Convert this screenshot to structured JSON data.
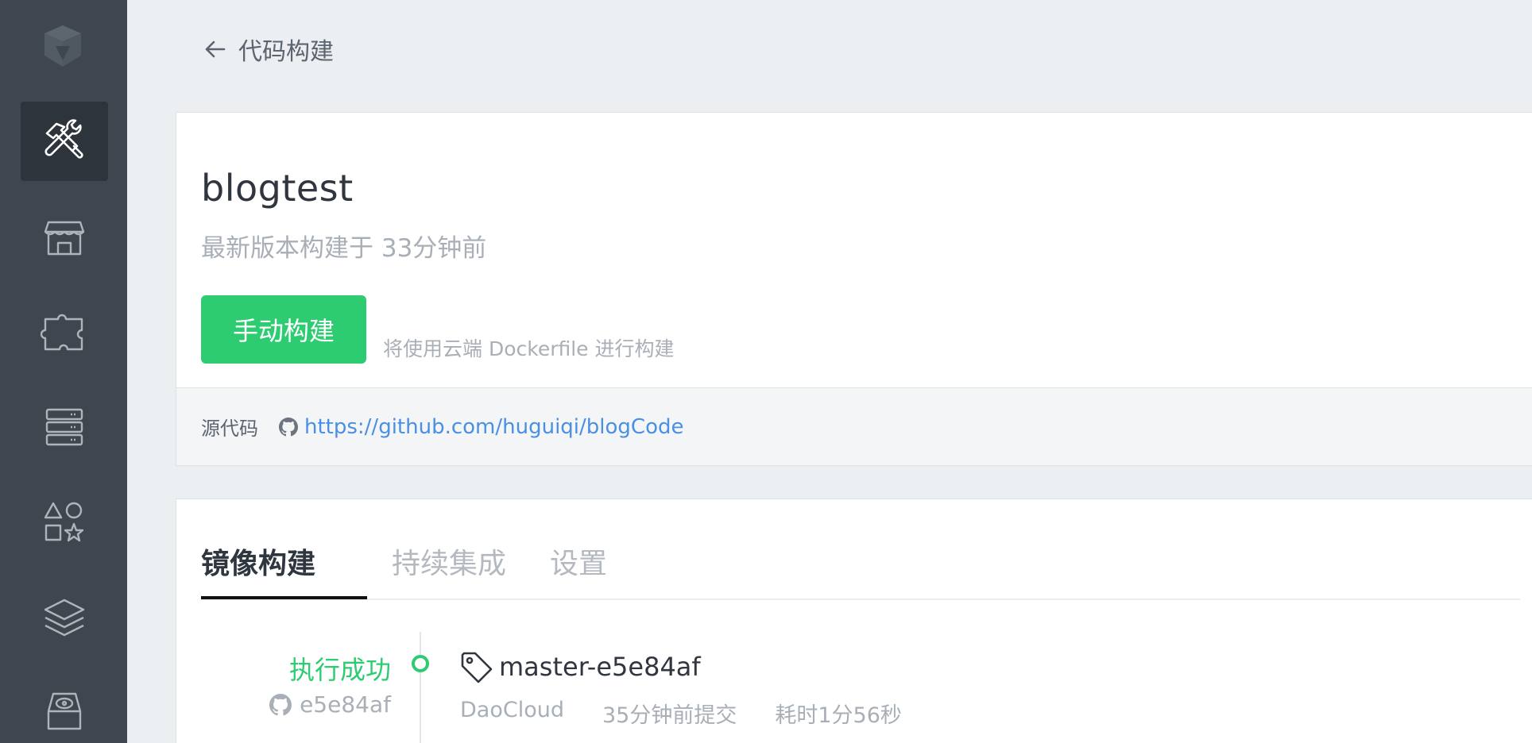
{
  "sidebar": {
    "logo": "daocloud-logo-icon",
    "items": [
      {
        "icon": "build-tools-icon",
        "active": true
      },
      {
        "icon": "store-icon",
        "active": false
      },
      {
        "icon": "puzzle-icon",
        "active": false
      },
      {
        "icon": "server-icon",
        "active": false
      },
      {
        "icon": "shapes-icon",
        "active": false
      },
      {
        "icon": "layers-icon",
        "active": false
      },
      {
        "icon": "disk-icon",
        "active": false
      }
    ]
  },
  "header": {
    "back_label": "代码构建"
  },
  "app": {
    "name": "blogtest",
    "subtitle": "最新版本构建于 33分钟前",
    "build_button": "手动构建",
    "build_hint": "将使用云端 Dockerfile 进行构建"
  },
  "source": {
    "label": "源代码",
    "url": "https://github.com/huguiqi/blogCode"
  },
  "tabs": [
    {
      "label": "镜像构建",
      "active": true
    },
    {
      "label": "持续集成",
      "active": false
    },
    {
      "label": "设置",
      "active": false
    }
  ],
  "build": {
    "status": "执行成功",
    "commit": "e5e84af",
    "tag": "master-e5e84af",
    "builder": "DaoCloud",
    "committed": "35分钟前提交",
    "duration": "耗时1分56秒"
  },
  "colors": {
    "sidebar_bg": "#3f464f",
    "sidebar_active_bg": "#2e343b",
    "accent_green": "#2ecc71",
    "link_blue": "#4a90e2"
  }
}
